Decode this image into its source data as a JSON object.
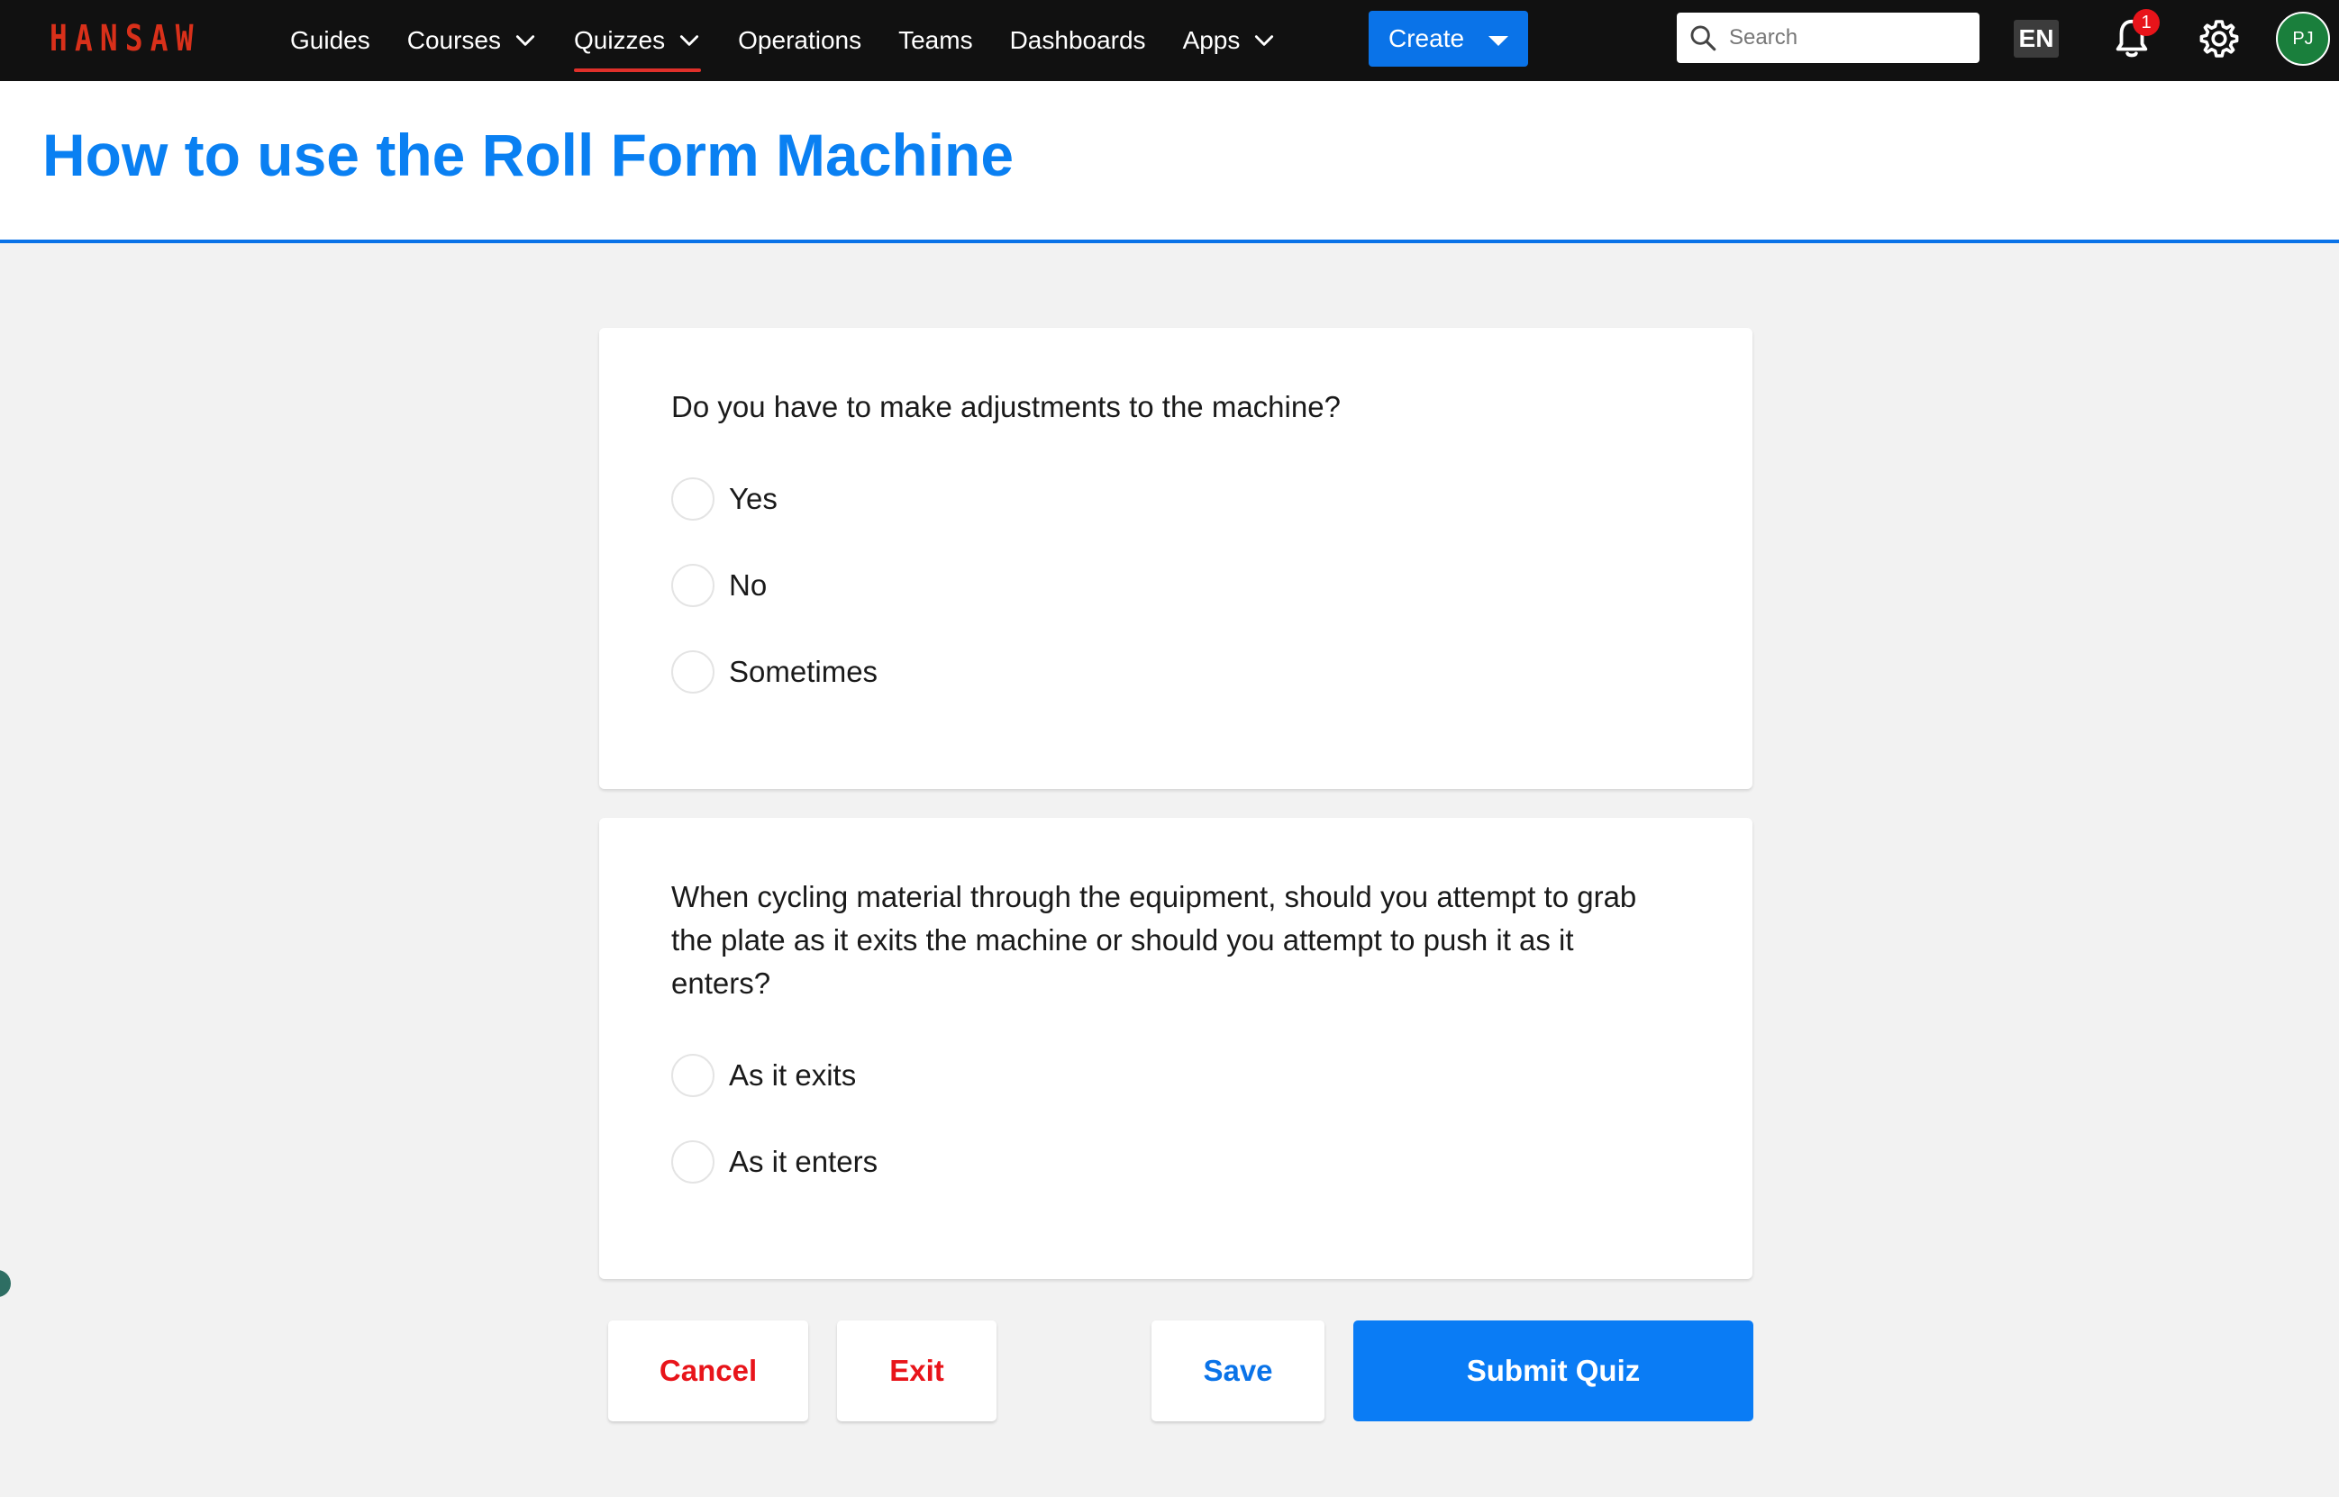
{
  "nav": {
    "logo": "HANSAW",
    "items": [
      {
        "label": "Guides",
        "dropdown": false,
        "active": false
      },
      {
        "label": "Courses",
        "dropdown": true,
        "active": false
      },
      {
        "label": "Quizzes",
        "dropdown": true,
        "active": true
      },
      {
        "label": "Operations",
        "dropdown": false,
        "active": false
      },
      {
        "label": "Teams",
        "dropdown": false,
        "active": false
      },
      {
        "label": "Dashboards",
        "dropdown": false,
        "active": false
      },
      {
        "label": "Apps",
        "dropdown": true,
        "active": false
      }
    ],
    "create_label": "Create",
    "search_placeholder": "Search",
    "language": "EN",
    "notification_count": "1",
    "avatar_initials": "PJ"
  },
  "page": {
    "title": "How to use the Roll Form Machine"
  },
  "quiz": {
    "questions": [
      {
        "text": "Do you have to make adjustments to the machine?",
        "options": [
          "Yes",
          "No",
          "Sometimes"
        ]
      },
      {
        "text": "When cycling material through the equipment, should you attempt to grab the plate as it exits the machine or should you attempt to push it as it enters?",
        "options": [
          "As it exits",
          "As it enters"
        ]
      }
    ]
  },
  "actions": {
    "cancel": "Cancel",
    "exit": "Exit",
    "save": "Save",
    "submit": "Submit Quiz"
  },
  "colors": {
    "nav_bg": "#111111",
    "logo": "#d9301a",
    "accent": "#0a73e8",
    "title": "#0a80f2",
    "danger": "#e8141a",
    "avatar": "#1a7f3c"
  },
  "icons": {
    "search": "search-icon",
    "bell": "bell-icon",
    "gear": "gear-icon",
    "chevron": "chevron-down-icon",
    "caret": "caret-down-icon"
  }
}
